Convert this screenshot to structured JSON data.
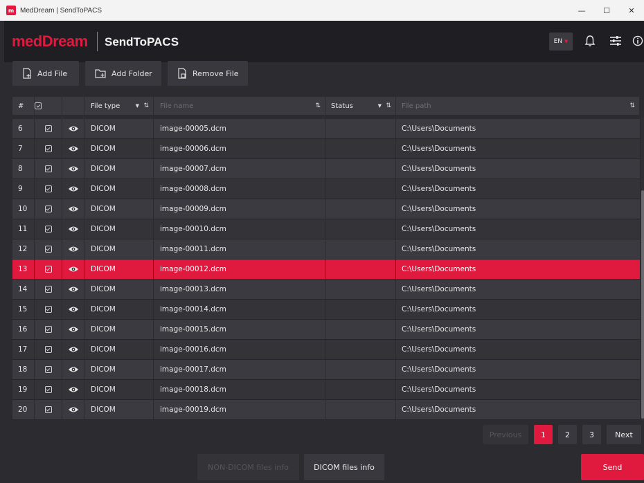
{
  "window": {
    "title": "MedDream | SendToPACS",
    "app_icon": "m"
  },
  "header": {
    "logo": "medDream",
    "product": "SendToPACS",
    "language": "EN"
  },
  "toolbar": {
    "add_file": "Add File",
    "add_folder": "Add Folder",
    "remove_file": "Remove File"
  },
  "table": {
    "columns": {
      "num": "#",
      "file_type": "File type",
      "file_name_placeholder": "File name",
      "status": "Status",
      "file_path_placeholder": "File path"
    },
    "selected_row": "13",
    "rows": [
      {
        "num": "6",
        "type": "DICOM",
        "name": "image-00005.dcm",
        "status": "",
        "path": "C:\\Users\\Documents"
      },
      {
        "num": "7",
        "type": "DICOM",
        "name": "image-00006.dcm",
        "status": "",
        "path": "C:\\Users\\Documents"
      },
      {
        "num": "8",
        "type": "DICOM",
        "name": "image-00007.dcm",
        "status": "",
        "path": "C:\\Users\\Documents"
      },
      {
        "num": "9",
        "type": "DICOM",
        "name": "image-00008.dcm",
        "status": "",
        "path": "C:\\Users\\Documents"
      },
      {
        "num": "10",
        "type": "DICOM",
        "name": "image-00009.dcm",
        "status": "",
        "path": "C:\\Users\\Documents"
      },
      {
        "num": "11",
        "type": "DICOM",
        "name": "image-00010.dcm",
        "status": "",
        "path": "C:\\Users\\Documents"
      },
      {
        "num": "12",
        "type": "DICOM",
        "name": "image-00011.dcm",
        "status": "",
        "path": "C:\\Users\\Documents"
      },
      {
        "num": "13",
        "type": "DICOM",
        "name": "image-00012.dcm",
        "status": "",
        "path": "C:\\Users\\Documents"
      },
      {
        "num": "14",
        "type": "DICOM",
        "name": "image-00013.dcm",
        "status": "",
        "path": "C:\\Users\\Documents"
      },
      {
        "num": "15",
        "type": "DICOM",
        "name": "image-00014.dcm",
        "status": "",
        "path": "C:\\Users\\Documents"
      },
      {
        "num": "16",
        "type": "DICOM",
        "name": "image-00015.dcm",
        "status": "",
        "path": "C:\\Users\\Documents"
      },
      {
        "num": "17",
        "type": "DICOM",
        "name": "image-00016.dcm",
        "status": "",
        "path": "C:\\Users\\Documents"
      },
      {
        "num": "18",
        "type": "DICOM",
        "name": "image-00017.dcm",
        "status": "",
        "path": "C:\\Users\\Documents"
      },
      {
        "num": "19",
        "type": "DICOM",
        "name": "image-00018.dcm",
        "status": "",
        "path": "C:\\Users\\Documents"
      },
      {
        "num": "20",
        "type": "DICOM",
        "name": "image-00019.dcm",
        "status": "",
        "path": "C:\\Users\\Documents"
      }
    ]
  },
  "pagination": {
    "previous": "Previous",
    "pages": [
      "1",
      "2",
      "3"
    ],
    "current": "1",
    "next": "Next"
  },
  "footer": {
    "non_dicom": "NON-DICOM files info",
    "dicom": "DICOM files info",
    "send": "Send"
  },
  "colors": {
    "accent": "#e0193e",
    "background": "#2b2b30",
    "header": "#1f1f23"
  },
  "icons": [
    "eye-icon",
    "checkbox-icon",
    "bell-icon",
    "sliders-icon",
    "info-icon",
    "sort-icon"
  ]
}
